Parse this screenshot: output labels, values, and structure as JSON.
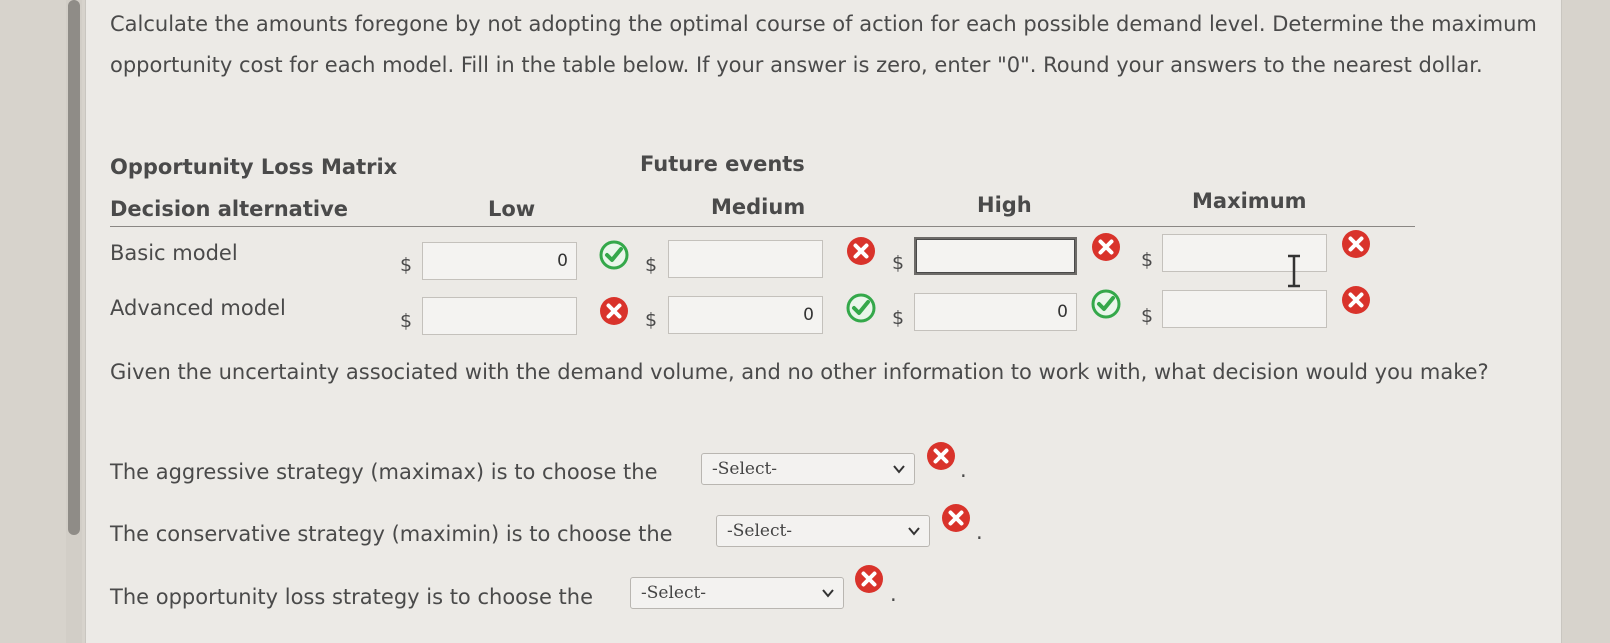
{
  "intro_text": "Calculate the amounts foregone by not adopting the optimal course of action for each possible demand level. Determine the maximum opportunity cost for each model. Fill in the table below. If your answer is zero, enter \"0\". Round your answers to the nearest dollar.",
  "table": {
    "title": "Opportunity Loss Matrix",
    "group_header": "Future events",
    "row_header": "Decision alternative",
    "columns": [
      "Low",
      "Medium",
      "High",
      "Maximum"
    ],
    "currency": "$",
    "rows": [
      {
        "label": "Basic model",
        "cells": [
          {
            "value": "0",
            "status": "correct"
          },
          {
            "value": "",
            "status": "incorrect"
          },
          {
            "value": "",
            "status": "incorrect"
          },
          {
            "value": "",
            "status": "incorrect"
          }
        ]
      },
      {
        "label": "Advanced model",
        "cells": [
          {
            "value": "",
            "status": "incorrect"
          },
          {
            "value": "0",
            "status": "correct"
          },
          {
            "value": "0",
            "status": "correct"
          },
          {
            "value": "",
            "status": "incorrect"
          }
        ]
      }
    ]
  },
  "question": "Given the uncertainty associated with the demand volume, and no other information to work with, what decision would you make?",
  "strategies": [
    {
      "text": "The aggressive strategy (maximax) is to choose the",
      "selected": "-Select-",
      "status": "incorrect"
    },
    {
      "text": "The conservative strategy (maximin) is to choose the",
      "selected": "-Select-",
      "status": "incorrect"
    },
    {
      "text": "The opportunity loss strategy is to choose the",
      "selected": "-Select-",
      "status": "incorrect"
    }
  ],
  "period": ".",
  "colors": {
    "correct": "#34a84a",
    "incorrect": "#d9332b"
  },
  "icons": {
    "correct": "check-circle-icon",
    "incorrect": "x-circle-icon",
    "dropdown": "chevron-down-icon"
  }
}
